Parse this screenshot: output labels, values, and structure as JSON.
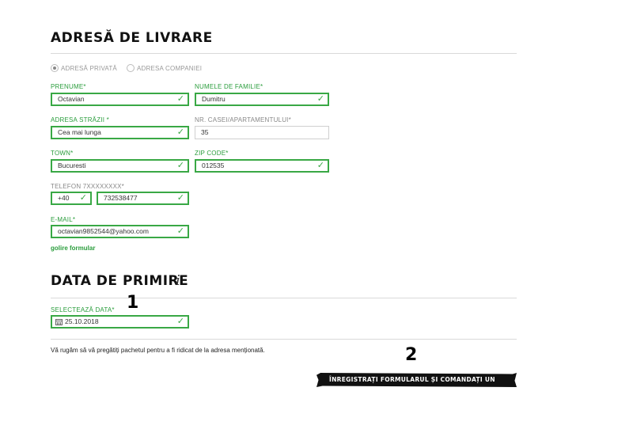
{
  "shipping": {
    "title": "ADRESĂ DE LIVRARE",
    "address_type": {
      "private_label": "ADRESĂ PRIVATĂ",
      "company_label": "ADRESA COMPANIEI",
      "selected": "private"
    },
    "first_name": {
      "label": "PRENUME*",
      "value": "Octavian",
      "valid": true
    },
    "last_name": {
      "label": "NUMELE DE FAMILIE*",
      "value": "Dumitru",
      "valid": true
    },
    "street": {
      "label": "ADRESA STRĂZII *",
      "value": "Cea mai lunga",
      "valid": true
    },
    "house_no": {
      "label": "NR. CASEI/APARTAMENTULUI*",
      "value": "35",
      "valid": false
    },
    "town": {
      "label": "TOWN*",
      "value": "Bucuresti",
      "valid": true
    },
    "zip": {
      "label": "ZIP CODE*",
      "value": "012535",
      "valid": true
    },
    "phone": {
      "label": "TELEFON 7XXXXXXXX*",
      "prefix": "+40",
      "value": "732538477",
      "valid": true
    },
    "email": {
      "label": "E-MAIL*",
      "value": "octavian9852544@yahoo.com",
      "valid": true
    },
    "reset_link": "golire formular"
  },
  "delivery_date": {
    "title": "DATA DE PRIMIRE",
    "info_icon": "info-icon",
    "label": "SELECTEAZĂ DATA*",
    "value": "25.10.2018",
    "calendar_icon": "calendar-icon"
  },
  "notice": "Vă rugăm să vă pregătiți pachetul pentru a fi ridicat de la adresa menționată.",
  "submit_label": "ÎNREGISTRAȚI FORMULARUL ȘI COMANDAȚI UN CURIER. ❯",
  "annotations": {
    "one": "1",
    "two": "2"
  },
  "colors": {
    "accent": "#39a845",
    "label_green": "#2a9d3c",
    "button_bg": "#111111"
  },
  "check_glyph": "✓"
}
